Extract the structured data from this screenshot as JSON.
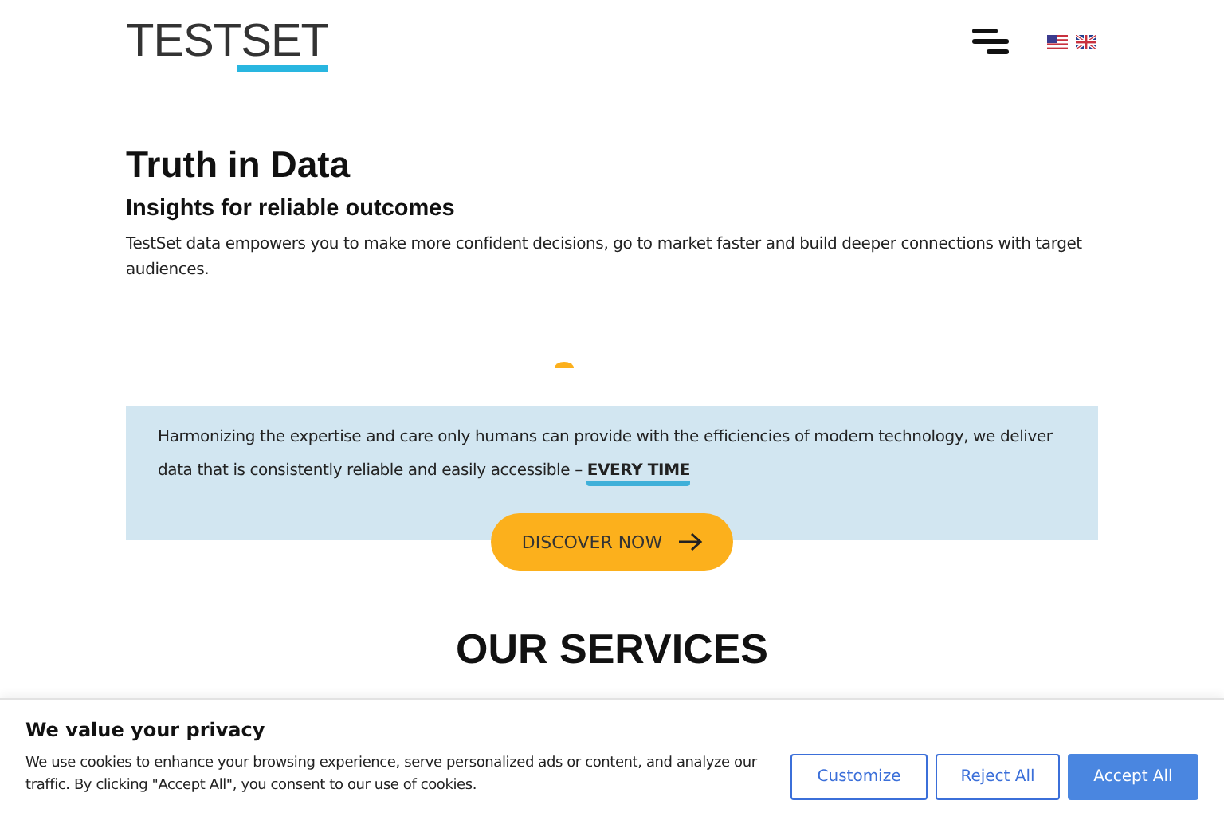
{
  "header": {
    "logo": "TESTSET",
    "languages": [
      {
        "kind": "us"
      },
      {
        "kind": "gb"
      }
    ]
  },
  "hero": {
    "title": "Truth in Data",
    "subtitle": "Insights for reliable outcomes",
    "body": "TestSet data empowers you to make more confident decisions, go to market faster and build deeper connections with target audiences."
  },
  "banner": {
    "text": "Harmonizing the expertise and care only humans can provide with the efficiencies of modern technology, we deliver data that is consistently reliable and easily accessible – **EVERY TIME**",
    "button": "DISCOVER NOW"
  },
  "services": {
    "title": "OUR SERVICES"
  },
  "cookie_banner": {
    "title": "We value your privacy",
    "text": "We use cookies to enhance your browsing experience, serve personalized ads or content, and analyze our traffic. By clicking \"Accept All\", you consent to our use of cookies.",
    "buttons": [
      {
        "label": "Customize",
        "kind": "outline"
      },
      {
        "label": "Reject All",
        "kind": "outline"
      },
      {
        "label": "Accept All",
        "kind": "primary"
      }
    ]
  }
}
